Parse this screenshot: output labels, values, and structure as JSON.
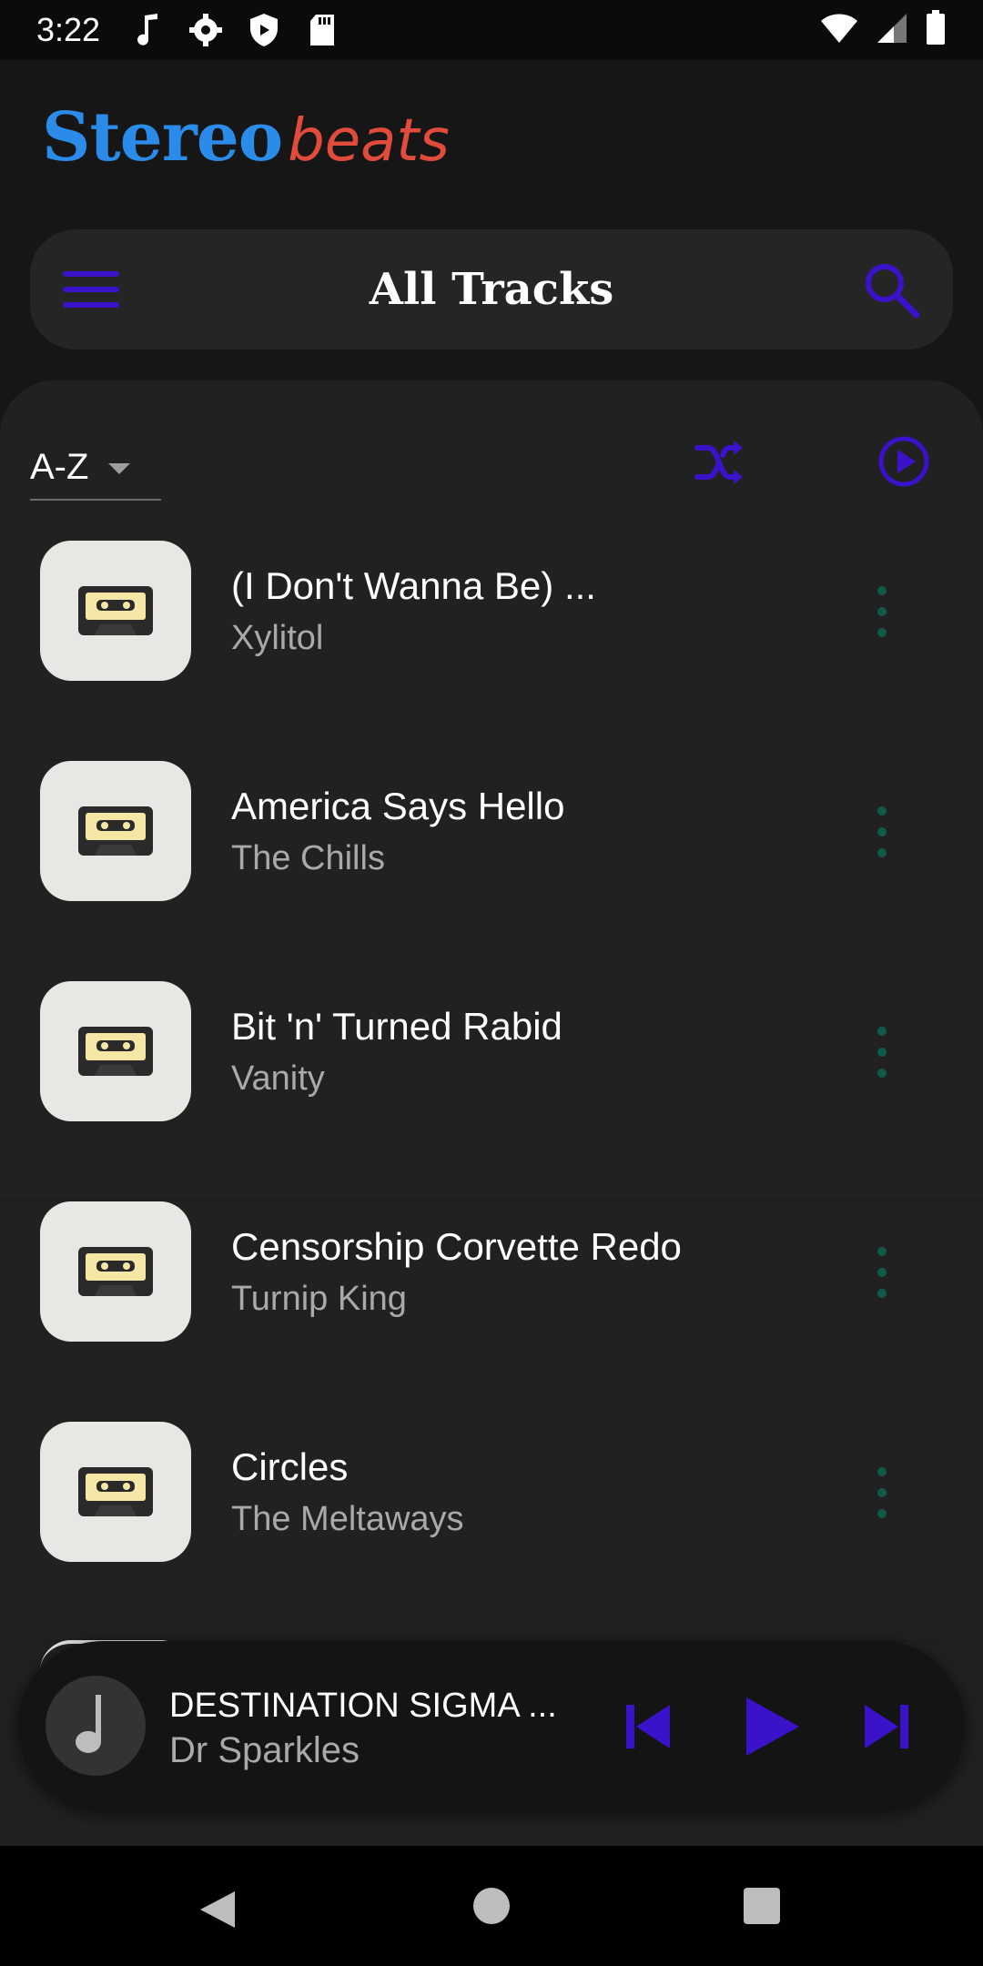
{
  "status_bar": {
    "time": "3:22",
    "left_icons": [
      "music-note-icon",
      "gear-icon",
      "shield-icon",
      "sd-card-icon"
    ],
    "right_icons": [
      "wifi-icon",
      "cell-signal-icon",
      "battery-icon"
    ]
  },
  "brand": {
    "main": "Stereo",
    "sub": "beats",
    "main_color": "#2b8be8",
    "sub_color": "#e04b3c"
  },
  "header": {
    "title": "All Tracks",
    "accent_color": "#3a12c9"
  },
  "controls": {
    "sort_label": "A-Z"
  },
  "tracks": [
    {
      "title": "(I Don't Wanna Be) ...",
      "artist": "Xylitol"
    },
    {
      "title": "America Says Hello",
      "artist": "The Chills"
    },
    {
      "title": "Bit 'n' Turned Rabid",
      "artist": "Vanity"
    },
    {
      "title": "Censorship Corvette Redo",
      "artist": "Turnip King"
    },
    {
      "title": "Circles",
      "artist": "The Meltaways"
    }
  ],
  "now_playing": {
    "title": "DESTINATION SIGMA ...",
    "artist": "Dr Sparkles"
  },
  "colors": {
    "background": "#161616",
    "surface": "#212121",
    "card": "#252525",
    "more_dots": "#0f5b4a"
  }
}
